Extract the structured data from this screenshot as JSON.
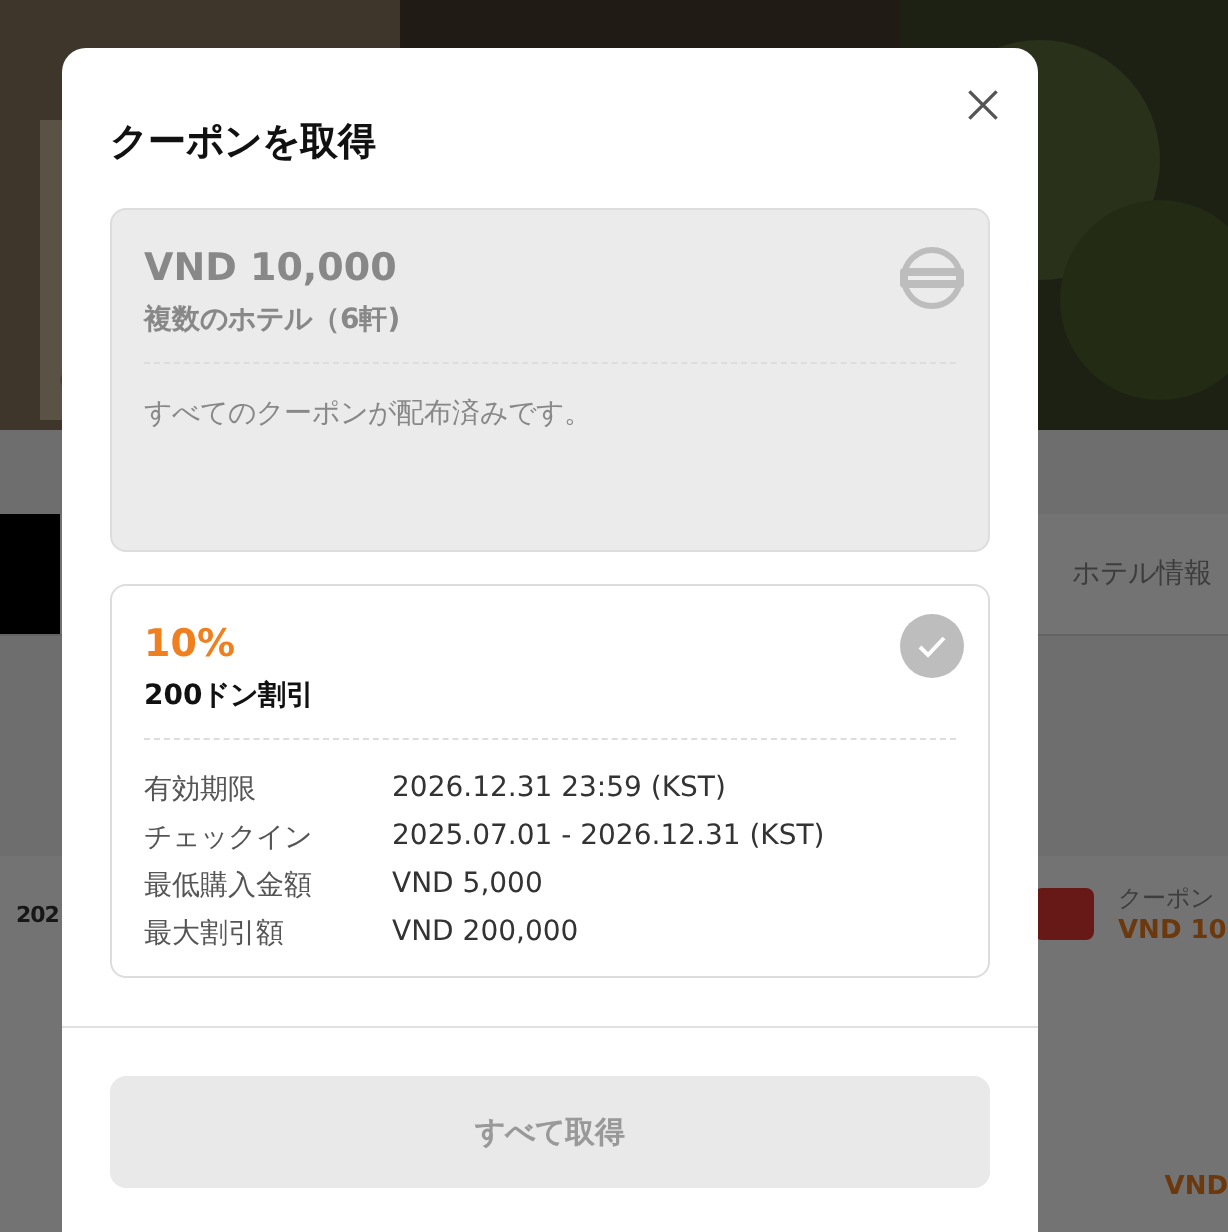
{
  "background": {
    "tab_label": "ホテル情報",
    "row": {
      "date": "202",
      "label": "クーポン",
      "amount": "VND 10"
    },
    "price": "VND"
  },
  "modal": {
    "title": "クーポンを取得",
    "coupons": [
      {
        "kind": "sold_out",
        "amount": "VND 10,000",
        "subtitle": "複数のホテル（6軒)",
        "message": "すべてのクーポンが配布済みです。"
      },
      {
        "kind": "available",
        "amount": "10%",
        "subtitle": "200ドン割引",
        "acquired": false,
        "details": [
          {
            "label": "有効期限",
            "value": "2026.12.31 23:59 (KST)"
          },
          {
            "label": "チェックイン",
            "value": "2025.07.01 - 2026.12.31 (KST)"
          },
          {
            "label": "最低購入金額",
            "value": "VND 5,000"
          },
          {
            "label": "最大割引額",
            "value": "VND 200,000"
          }
        ]
      }
    ],
    "button": {
      "label": "すべて取得",
      "disabled": true
    }
  }
}
